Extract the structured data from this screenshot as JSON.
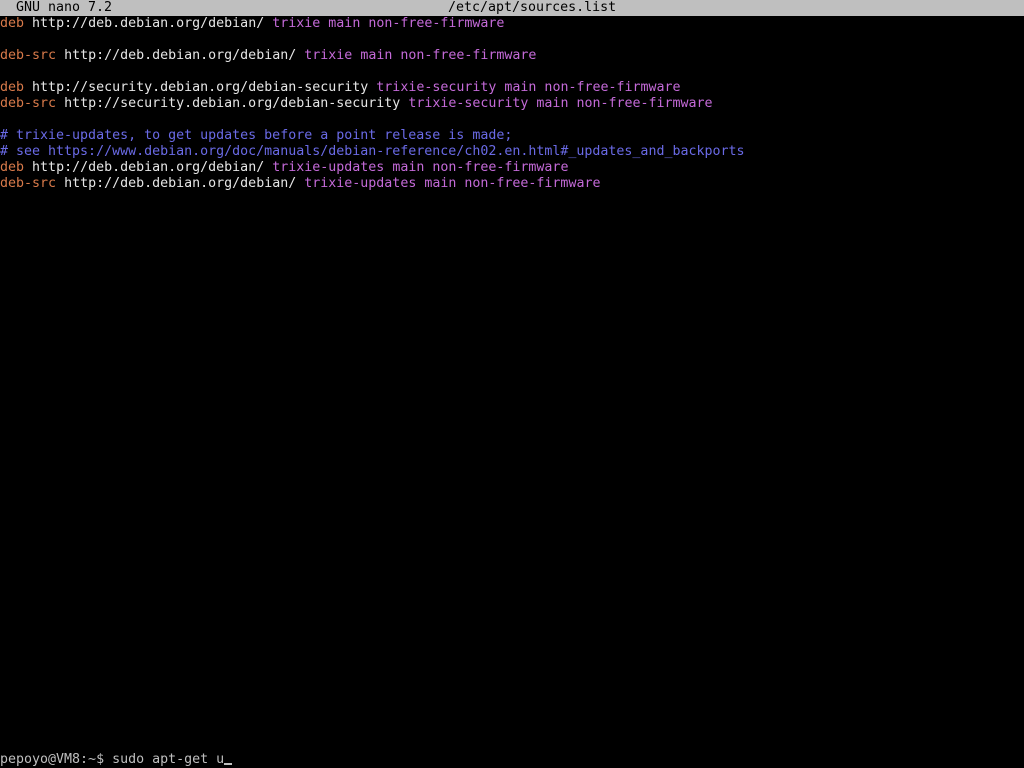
{
  "titlebar": {
    "app": "GNU nano 7.2",
    "file": "/etc/apt/sources.list"
  },
  "lines": [
    {
      "type": "entry",
      "kw": "deb",
      "url": "http://deb.debian.org/debian/",
      "suite": "trixie",
      "components": "main non-free-firmware"
    },
    {
      "type": "blank"
    },
    {
      "type": "entry",
      "kw": "deb-src",
      "url": "http://deb.debian.org/debian/",
      "suite": "trixie",
      "components": "main non-free-firmware"
    },
    {
      "type": "blank"
    },
    {
      "type": "entry",
      "kw": "deb",
      "url": "http://security.debian.org/debian-security",
      "suite": "trixie-security",
      "components": "main non-free-firmware"
    },
    {
      "type": "entry",
      "kw": "deb-src",
      "url": "http://security.debian.org/debian-security",
      "suite": "trixie-security",
      "components": "main non-free-firmware"
    },
    {
      "type": "blank"
    },
    {
      "type": "comment",
      "text": "# trixie-updates, to get updates before a point release is made;"
    },
    {
      "type": "comment",
      "text": "# see https://www.debian.org/doc/manuals/debian-reference/ch02.en.html#_updates_and_backports"
    },
    {
      "type": "entry",
      "kw": "deb",
      "url": "http://deb.debian.org/debian/",
      "suite": "trixie-updates",
      "components": "main non-free-firmware"
    },
    {
      "type": "entry",
      "kw": "deb-src",
      "url": "http://deb.debian.org/debian/",
      "suite": "trixie-updates",
      "components": "main non-free-firmware"
    }
  ],
  "shell": {
    "prompt": "pepoyo@VM8:~$",
    "command": "sudo apt-get u"
  },
  "colors": {
    "background": "#000000",
    "titlebar_bg": "#bfbfbf",
    "keyword": "#d87a4a",
    "url": "#e6e6e6",
    "suite": "#c46ad8",
    "comment": "#6a6ae6"
  }
}
